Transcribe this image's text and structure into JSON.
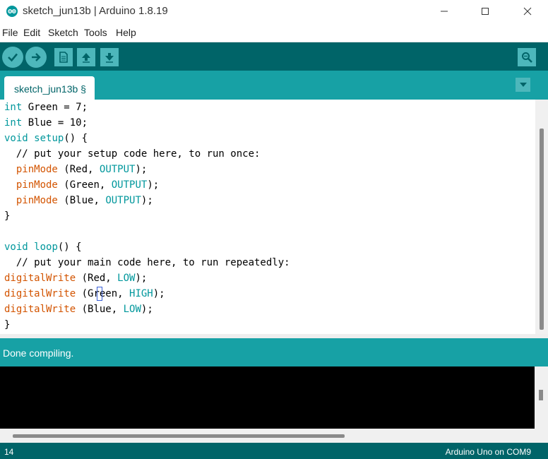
{
  "window": {
    "title": "sketch_jun13b | Arduino 1.8.19"
  },
  "menu": [
    "File",
    "Edit",
    "Sketch",
    "Tools",
    "Help"
  ],
  "toolbar": {
    "icons": [
      "verify-icon",
      "upload-icon",
      "new-icon",
      "open-icon",
      "save-icon",
      "serial-monitor-icon"
    ]
  },
  "tabs": [
    {
      "label": "sketch_jun13b §"
    }
  ],
  "editor": {
    "lines": [
      [
        {
          "t": "int",
          "c": "kw"
        },
        {
          "t": " Green = 7;",
          "c": ""
        }
      ],
      [
        {
          "t": "int",
          "c": "kw"
        },
        {
          "t": " Blue = 10;",
          "c": ""
        }
      ],
      [
        {
          "t": "void",
          "c": "kw"
        },
        {
          "t": " ",
          "c": ""
        },
        {
          "t": "setup",
          "c": "kw"
        },
        {
          "t": "() {",
          "c": ""
        }
      ],
      [
        {
          "t": "  // put your setup code here, to run once:",
          "c": "cm"
        }
      ],
      [
        {
          "t": "  ",
          "c": ""
        },
        {
          "t": "pinMode",
          "c": "fn"
        },
        {
          "t": " (Red, ",
          "c": ""
        },
        {
          "t": "OUTPUT",
          "c": "cn"
        },
        {
          "t": ");",
          "c": ""
        }
      ],
      [
        {
          "t": "  ",
          "c": ""
        },
        {
          "t": "pinMode",
          "c": "fn"
        },
        {
          "t": " (Green, ",
          "c": ""
        },
        {
          "t": "OUTPUT",
          "c": "cn"
        },
        {
          "t": ");",
          "c": ""
        }
      ],
      [
        {
          "t": "  ",
          "c": ""
        },
        {
          "t": "pinMode",
          "c": "fn"
        },
        {
          "t": " (Blue, ",
          "c": ""
        },
        {
          "t": "OUTPUT",
          "c": "cn"
        },
        {
          "t": ");",
          "c": ""
        }
      ],
      [
        {
          "t": "}",
          "c": ""
        }
      ],
      [
        {
          "t": "",
          "c": ""
        }
      ],
      [
        {
          "t": "void",
          "c": "kw"
        },
        {
          "t": " ",
          "c": ""
        },
        {
          "t": "loop",
          "c": "kw"
        },
        {
          "t": "() {",
          "c": ""
        }
      ],
      [
        {
          "t": "  // put your main code here, to run repeatedly:",
          "c": "cm"
        }
      ],
      [
        {
          "t": "digitalWrite",
          "c": "fn"
        },
        {
          "t": " (Red, ",
          "c": ""
        },
        {
          "t": "LOW",
          "c": "cn"
        },
        {
          "t": ");",
          "c": ""
        }
      ],
      [
        {
          "t": "digitalWrite",
          "c": "fn"
        },
        {
          "t": " (Green, ",
          "c": ""
        },
        {
          "t": "HIGH",
          "c": "cn"
        },
        {
          "t": ");",
          "c": ""
        }
      ],
      [
        {
          "t": "digitalWrite",
          "c": "fn"
        },
        {
          "t": " (Blue, ",
          "c": ""
        },
        {
          "t": "LOW",
          "c": "cn"
        },
        {
          "t": ");",
          "c": ""
        }
      ],
      [
        {
          "t": "}",
          "c": ""
        }
      ]
    ]
  },
  "status": {
    "message": "Done compiling."
  },
  "footer": {
    "line": "14",
    "board": "Arduino Uno on COM9"
  },
  "colors": {
    "toolbar": "#006468",
    "tabbar": "#17a1a5",
    "button": "#4db7bb",
    "keyword": "#00979c",
    "function": "#d35400"
  }
}
